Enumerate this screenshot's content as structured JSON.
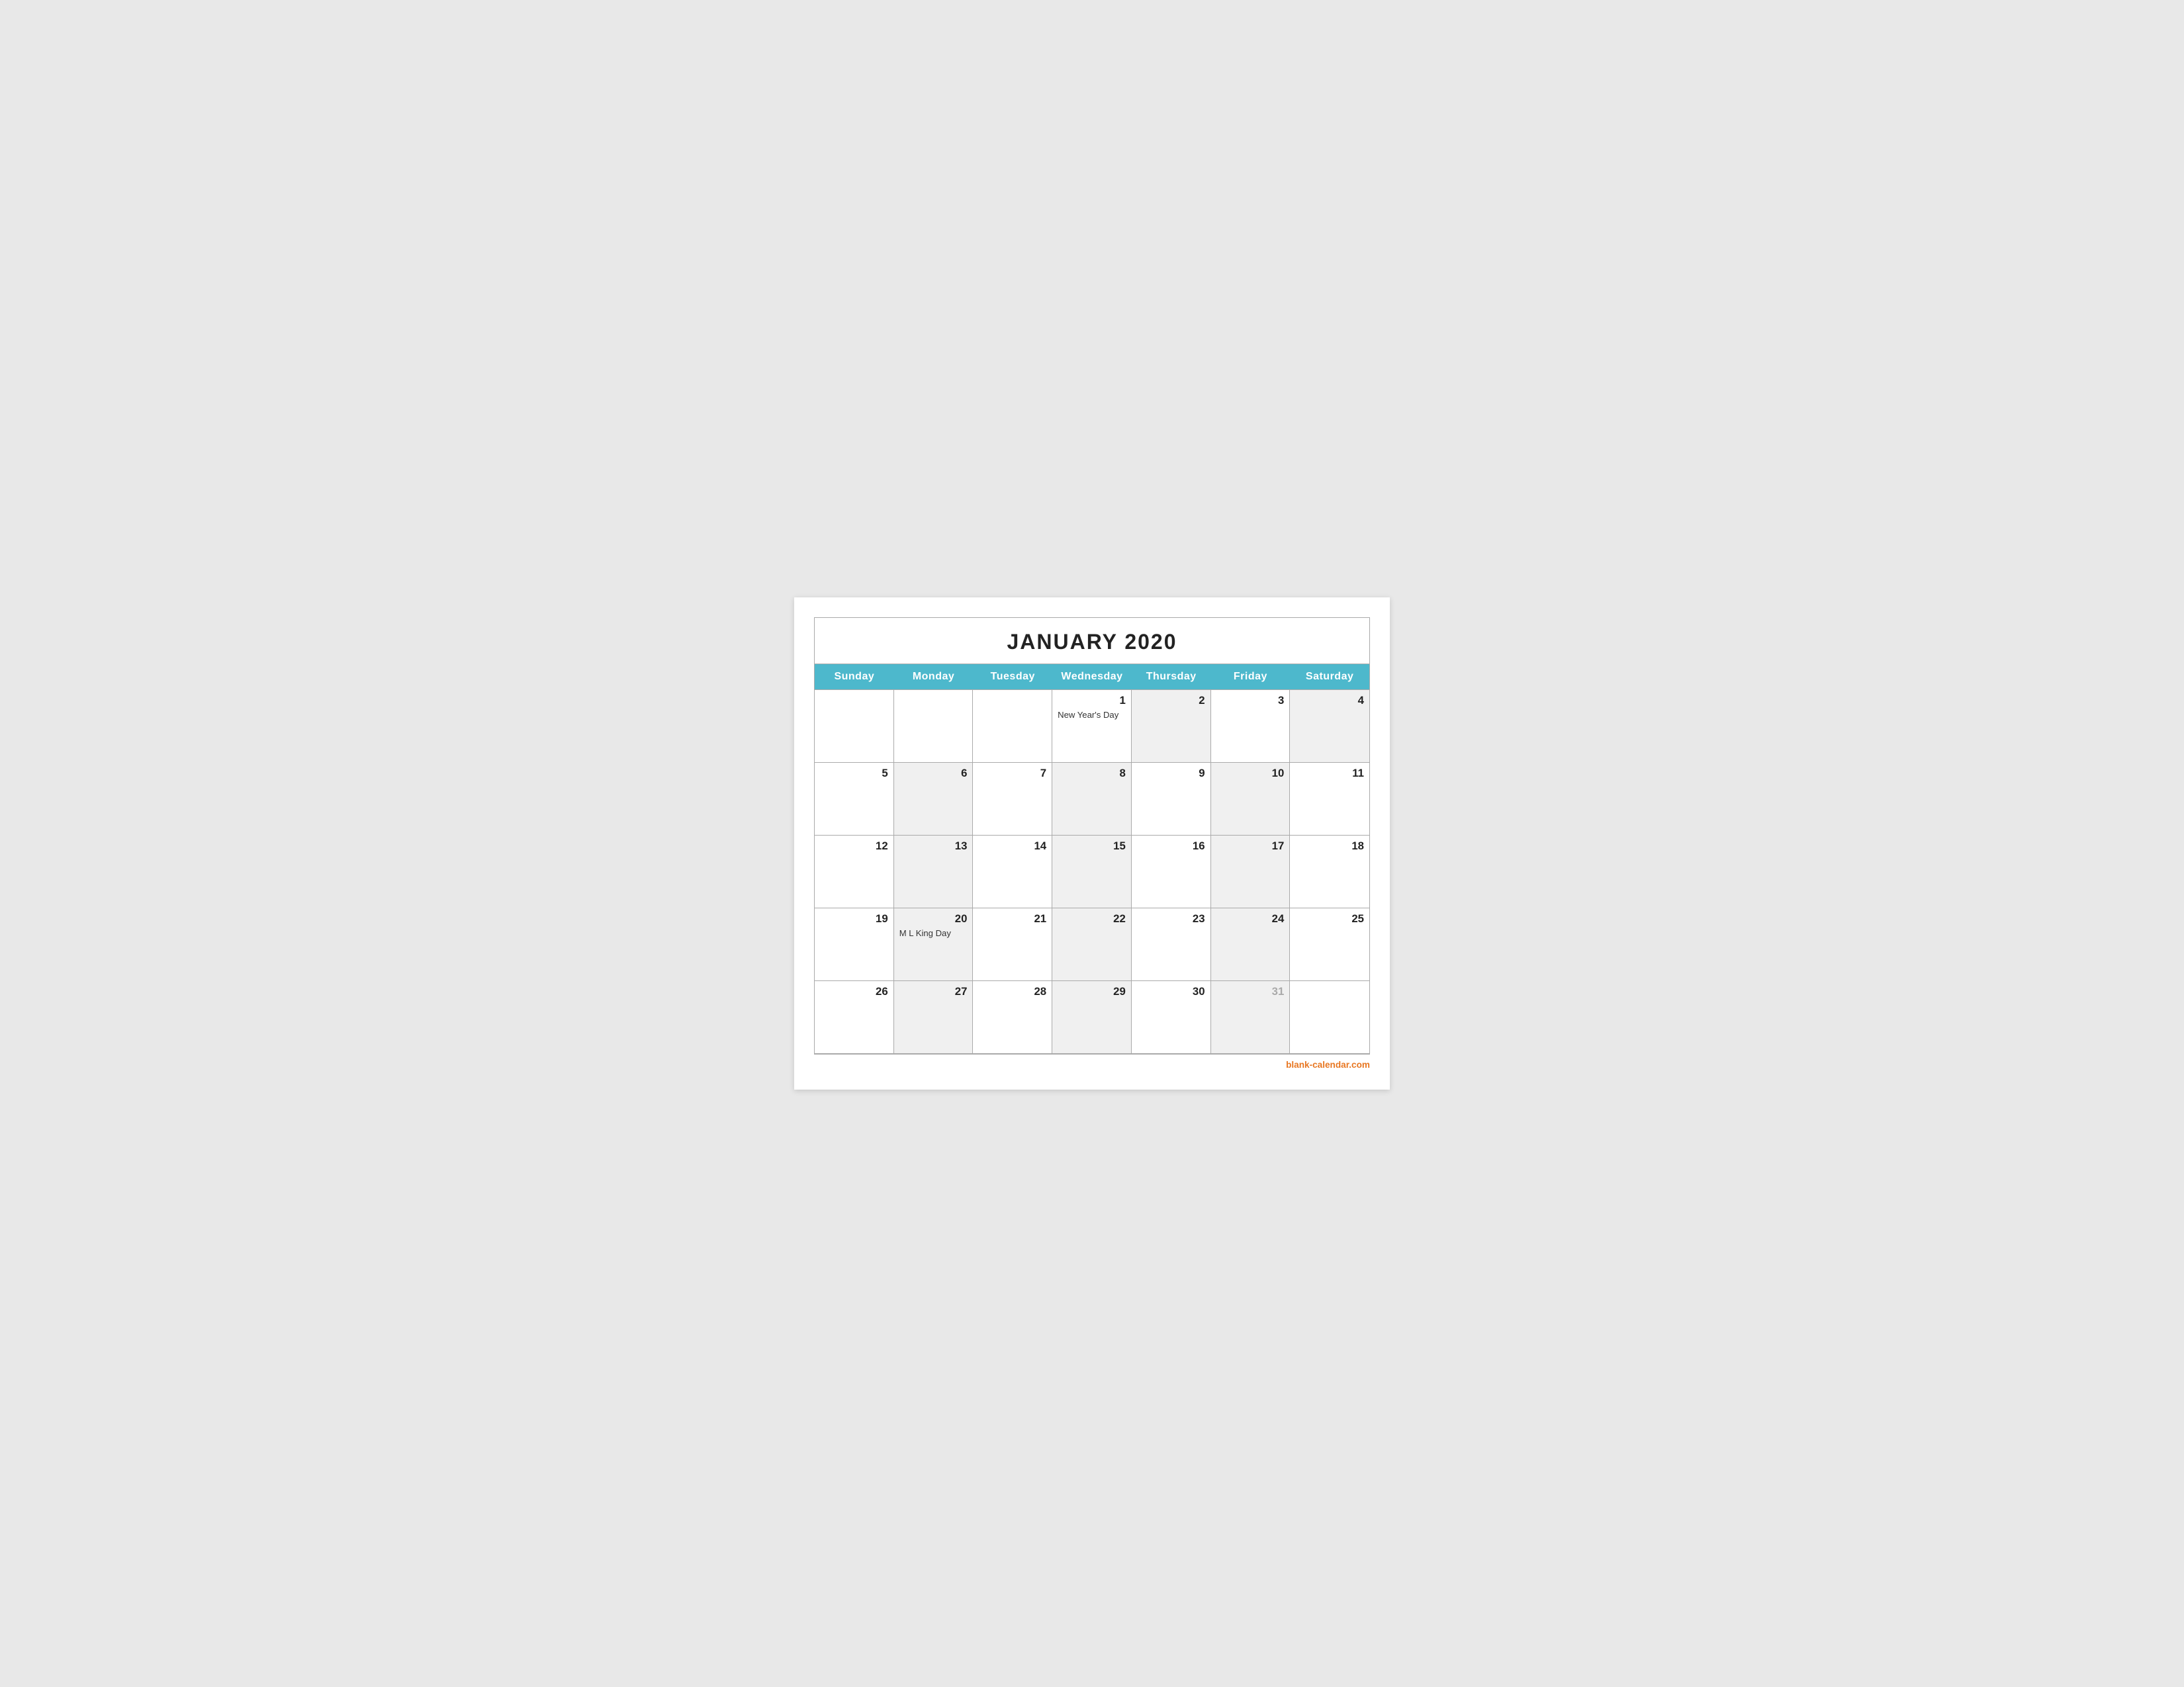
{
  "title": "JANUARY 2020",
  "days_of_week": [
    "Sunday",
    "Monday",
    "Tuesday",
    "Wednesday",
    "Thursday",
    "Friday",
    "Saturday"
  ],
  "weeks": [
    [
      {
        "date": "",
        "shaded": false,
        "event": ""
      },
      {
        "date": "",
        "shaded": false,
        "event": ""
      },
      {
        "date": "",
        "shaded": false,
        "event": ""
      },
      {
        "date": "1",
        "shaded": false,
        "event": "New Year's Day"
      },
      {
        "date": "2",
        "shaded": true,
        "event": ""
      },
      {
        "date": "3",
        "shaded": false,
        "event": ""
      },
      {
        "date": "4",
        "shaded": true,
        "event": ""
      }
    ],
    [
      {
        "date": "5",
        "shaded": false,
        "event": ""
      },
      {
        "date": "6",
        "shaded": true,
        "event": ""
      },
      {
        "date": "7",
        "shaded": false,
        "event": ""
      },
      {
        "date": "8",
        "shaded": true,
        "event": ""
      },
      {
        "date": "9",
        "shaded": false,
        "event": ""
      },
      {
        "date": "10",
        "shaded": true,
        "event": ""
      },
      {
        "date": "11",
        "shaded": false,
        "event": ""
      }
    ],
    [
      {
        "date": "12",
        "shaded": false,
        "event": ""
      },
      {
        "date": "13",
        "shaded": true,
        "event": ""
      },
      {
        "date": "14",
        "shaded": false,
        "event": ""
      },
      {
        "date": "15",
        "shaded": true,
        "event": ""
      },
      {
        "date": "16",
        "shaded": false,
        "event": ""
      },
      {
        "date": "17",
        "shaded": true,
        "event": ""
      },
      {
        "date": "18",
        "shaded": false,
        "event": ""
      }
    ],
    [
      {
        "date": "19",
        "shaded": false,
        "event": ""
      },
      {
        "date": "20",
        "shaded": true,
        "event": "M L King Day"
      },
      {
        "date": "21",
        "shaded": false,
        "event": ""
      },
      {
        "date": "22",
        "shaded": true,
        "event": ""
      },
      {
        "date": "23",
        "shaded": false,
        "event": ""
      },
      {
        "date": "24",
        "shaded": true,
        "event": ""
      },
      {
        "date": "25",
        "shaded": false,
        "event": ""
      }
    ],
    [
      {
        "date": "26",
        "shaded": false,
        "event": ""
      },
      {
        "date": "27",
        "shaded": true,
        "event": ""
      },
      {
        "date": "28",
        "shaded": false,
        "event": ""
      },
      {
        "date": "29",
        "shaded": true,
        "event": ""
      },
      {
        "date": "30",
        "shaded": false,
        "event": ""
      },
      {
        "date": "31",
        "shaded": true,
        "grayed": true,
        "event": ""
      },
      {
        "date": "",
        "shaded": false,
        "event": ""
      }
    ]
  ],
  "footer_link": "blank-calendar.com"
}
